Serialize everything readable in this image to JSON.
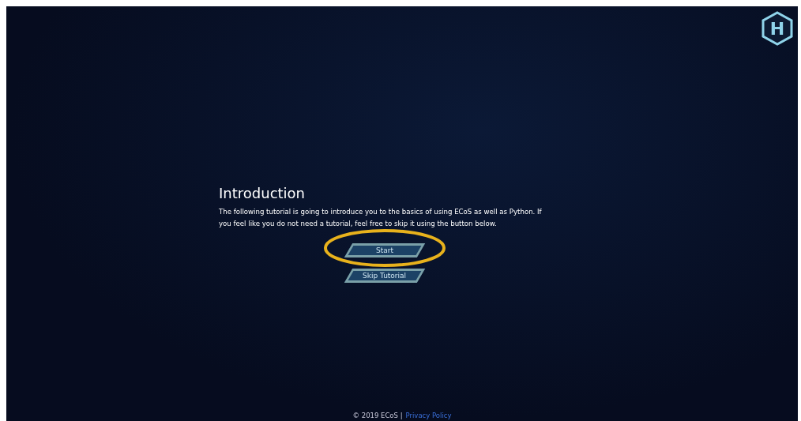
{
  "logo": {
    "letter": "H"
  },
  "intro": {
    "title": "Introduction",
    "text": "The following tutorial is going to introduce you to the basics of using ECoS as well as Python. If you feel like you do not need a tutorial, feel free to skip it using the button below."
  },
  "buttons": [
    {
      "label": "Start",
      "highlighted": true
    },
    {
      "label": "Skip Tutorial",
      "highlighted": false
    }
  ],
  "footer": {
    "copyright": "© 2019 ECoS |",
    "link": "Privacy Policy"
  }
}
